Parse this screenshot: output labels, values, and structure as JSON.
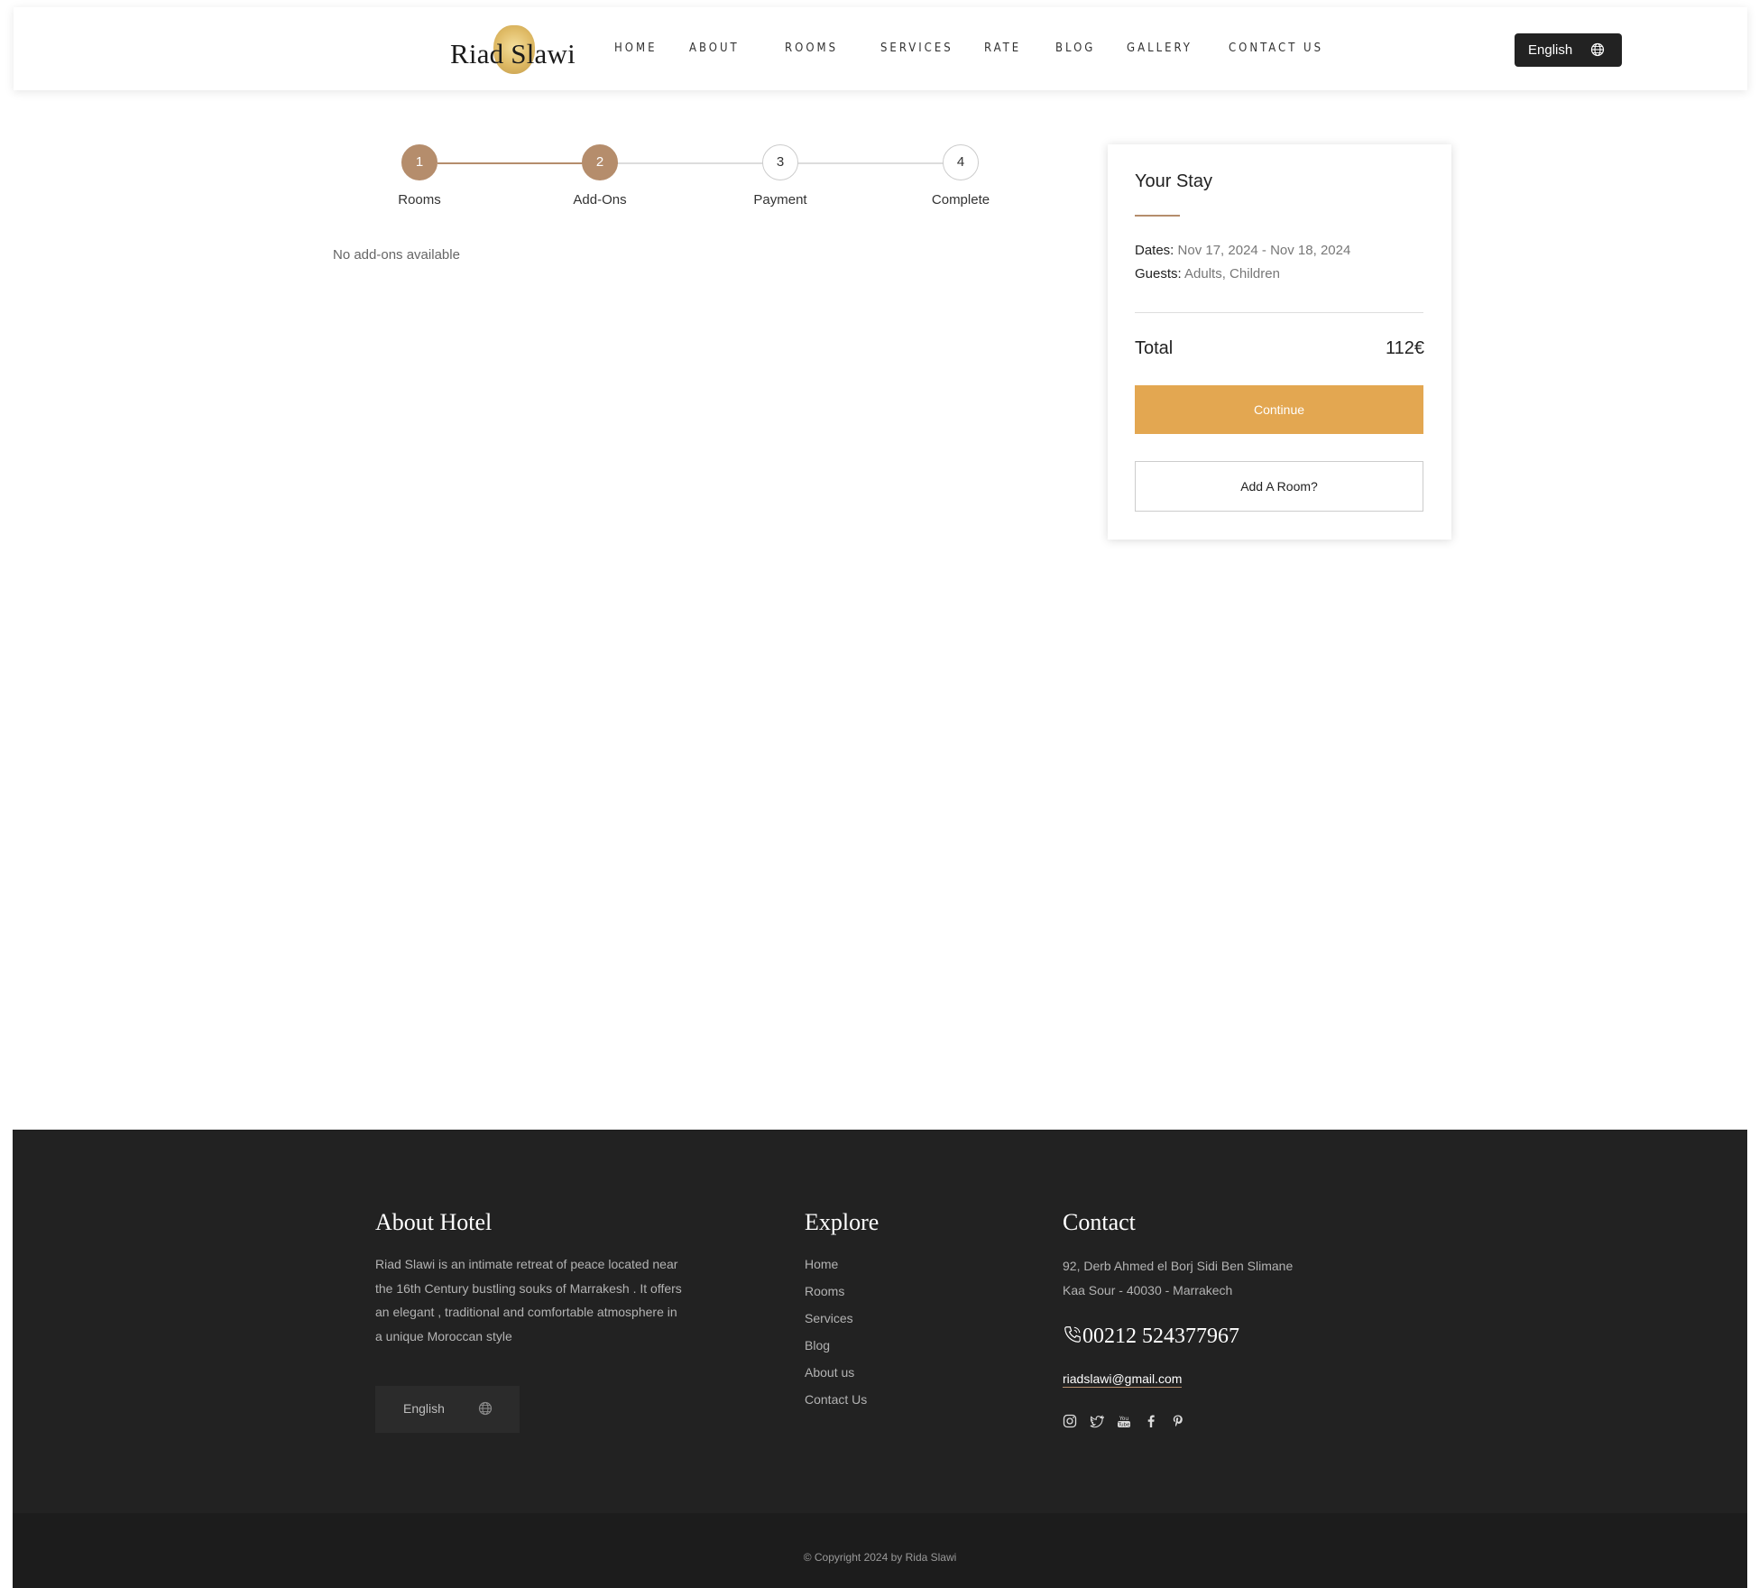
{
  "header": {
    "logo_text": "Riad Slawi",
    "nav": [
      "HOME",
      "ABOUT",
      "ROOMS",
      "SERVICES",
      "RATE",
      "BLOG",
      "GALLERY",
      "CONTACT US"
    ],
    "language": "English"
  },
  "stepper": {
    "steps": [
      {
        "number": "1",
        "label": "Rooms"
      },
      {
        "number": "2",
        "label": "Add-Ons"
      },
      {
        "number": "3",
        "label": "Payment"
      },
      {
        "number": "4",
        "label": "Complete"
      }
    ],
    "current_step": 2
  },
  "main": {
    "no_addons_text": "No add-ons available"
  },
  "stay_card": {
    "title": "Your Stay",
    "dates_label": "Dates:",
    "dates_value": "Nov 17, 2024 - Nov 18, 2024",
    "guests_label": "Guests:",
    "guests_value": "Adults, Children",
    "total_label": "Total",
    "total_value": "112€",
    "continue_label": "Continue",
    "add_room_label": "Add A Room?"
  },
  "footer": {
    "about_title": "About Hotel",
    "about_lines": [
      "Riad Slawi is an intimate retreat of peace located near",
      "the 16th Century bustling souks of Marrakesh . It offers",
      "an elegant , traditional and comfortable atmosphere in",
      "a unique Moroccan style"
    ],
    "language": "English",
    "explore_title": "Explore",
    "explore_links": [
      "Home",
      "Rooms",
      "Services",
      "Blog",
      "About us",
      "Contact Us"
    ],
    "contact_title": "Contact",
    "address_lines": [
      "92, Derb Ahmed el Borj Sidi Ben Slimane",
      "Kaa Sour - 40030 - Marrakech"
    ],
    "phone": "00212 524377967",
    "email": "riadslawi@gmail.com",
    "social_icons": [
      "instagram-icon",
      "twitter-icon",
      "youtube-icon",
      "facebook-icon",
      "pinterest-icon"
    ],
    "copyright": "© Copyright 2024 by Rida Slawi"
  },
  "colors": {
    "accent": "#b58d6c",
    "button": "#e3a751",
    "footer_bg": "#222222",
    "lang_btn": "#222222"
  }
}
